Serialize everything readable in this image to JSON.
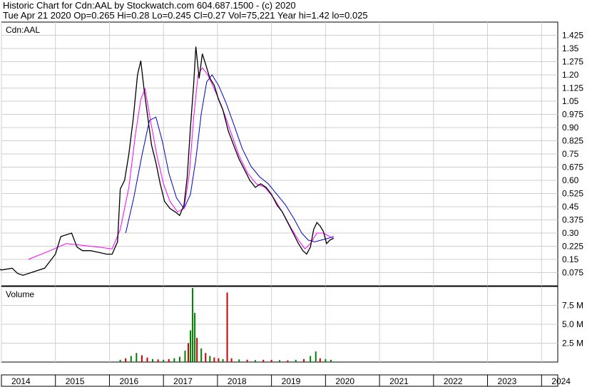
{
  "header": {
    "title": "Historic Chart for Cdn:AAL by Stockwatch.com 604.687.1500 - (c) 2020",
    "quote_line": "Tue Apr 21 2020  Op=0.265  Hi=0.28  Lo=0.245  Cl=0.27  Vol=75,221  Year hi=1.42  lo=0.025"
  },
  "chart_data": [
    {
      "type": "line",
      "title": "Cdn:AAL",
      "ylabel": "",
      "xlabel": "",
      "ylim": [
        0,
        1.5
      ],
      "y_ticks": [
        0.075,
        0.15,
        0.225,
        0.3,
        0.375,
        0.45,
        0.525,
        0.6,
        0.675,
        0.75,
        0.825,
        0.9,
        0.975,
        1.05,
        1.125,
        1.2,
        1.275,
        1.35,
        1.425
      ],
      "y_tick_labels": [
        "0.075",
        "0.15",
        "0.225",
        "0.30",
        "0.375",
        "0.45",
        "0.525",
        "0.60",
        "0.675",
        "0.75",
        "0.825",
        "0.90",
        "0.975",
        "1.05",
        "1.125",
        "1.20",
        "1.275",
        "1.35",
        "1.425"
      ],
      "x_labels": [
        "2014",
        "2015",
        "2016",
        "2017",
        "2018",
        "2019",
        "2020",
        "2021",
        "2022",
        "2023",
        "2024"
      ],
      "xlim": [
        2014.0,
        2024.3
      ],
      "grid": true,
      "colors": {
        "price": "#000000",
        "ma_short": "#ff00ff",
        "ma_long": "#0000cc",
        "up": "#008000",
        "down": "#cc0000"
      },
      "price_points": [
        [
          2013.85,
          0.11
        ],
        [
          2014.0,
          0.09
        ],
        [
          2014.2,
          0.1
        ],
        [
          2014.3,
          0.07
        ],
        [
          2014.4,
          0.06
        ],
        [
          2014.6,
          0.08
        ],
        [
          2014.8,
          0.1
        ],
        [
          2015.0,
          0.18
        ],
        [
          2015.1,
          0.28
        ],
        [
          2015.3,
          0.3
        ],
        [
          2015.4,
          0.22
        ],
        [
          2015.5,
          0.2
        ],
        [
          2015.65,
          0.2
        ],
        [
          2015.8,
          0.19
        ],
        [
          2015.95,
          0.18
        ],
        [
          2016.05,
          0.18
        ],
        [
          2016.15,
          0.25
        ],
        [
          2016.2,
          0.55
        ],
        [
          2016.28,
          0.6
        ],
        [
          2016.36,
          0.75
        ],
        [
          2016.44,
          0.95
        ],
        [
          2016.52,
          1.2
        ],
        [
          2016.58,
          1.28
        ],
        [
          2016.64,
          1.12
        ],
        [
          2016.7,
          0.98
        ],
        [
          2016.78,
          0.8
        ],
        [
          2016.86,
          0.7
        ],
        [
          2016.94,
          0.58
        ],
        [
          2017.02,
          0.48
        ],
        [
          2017.12,
          0.44
        ],
        [
          2017.22,
          0.42
        ],
        [
          2017.3,
          0.4
        ],
        [
          2017.38,
          0.46
        ],
        [
          2017.44,
          0.62
        ],
        [
          2017.5,
          0.9
        ],
        [
          2017.56,
          1.15
        ],
        [
          2017.6,
          1.36
        ],
        [
          2017.66,
          1.18
        ],
        [
          2017.72,
          1.32
        ],
        [
          2017.78,
          1.26
        ],
        [
          2017.86,
          1.18
        ],
        [
          2017.94,
          1.14
        ],
        [
          2018.02,
          1.06
        ],
        [
          2018.1,
          1.0
        ],
        [
          2018.2,
          0.88
        ],
        [
          2018.3,
          0.8
        ],
        [
          2018.4,
          0.72
        ],
        [
          2018.5,
          0.66
        ],
        [
          2018.6,
          0.6
        ],
        [
          2018.7,
          0.56
        ],
        [
          2018.8,
          0.58
        ],
        [
          2018.9,
          0.56
        ],
        [
          2019.0,
          0.52
        ],
        [
          2019.1,
          0.46
        ],
        [
          2019.2,
          0.42
        ],
        [
          2019.3,
          0.36
        ],
        [
          2019.4,
          0.3
        ],
        [
          2019.5,
          0.24
        ],
        [
          2019.58,
          0.2
        ],
        [
          2019.65,
          0.18
        ],
        [
          2019.72,
          0.22
        ],
        [
          2019.78,
          0.32
        ],
        [
          2019.84,
          0.36
        ],
        [
          2019.9,
          0.34
        ],
        [
          2019.96,
          0.31
        ],
        [
          2020.02,
          0.24
        ],
        [
          2020.08,
          0.26
        ],
        [
          2020.15,
          0.27
        ]
      ],
      "ma_short_points": [
        [
          2014.5,
          0.15
        ],
        [
          2014.9,
          0.2
        ],
        [
          2015.2,
          0.24
        ],
        [
          2015.5,
          0.23
        ],
        [
          2015.8,
          0.22
        ],
        [
          2016.05,
          0.21
        ],
        [
          2016.2,
          0.32
        ],
        [
          2016.36,
          0.56
        ],
        [
          2016.48,
          0.86
        ],
        [
          2016.58,
          1.06
        ],
        [
          2016.66,
          1.12
        ],
        [
          2016.76,
          0.94
        ],
        [
          2016.88,
          0.74
        ],
        [
          2017.0,
          0.58
        ],
        [
          2017.12,
          0.48
        ],
        [
          2017.26,
          0.42
        ],
        [
          2017.38,
          0.44
        ],
        [
          2017.48,
          0.64
        ],
        [
          2017.56,
          0.96
        ],
        [
          2017.64,
          1.2
        ],
        [
          2017.72,
          1.24
        ],
        [
          2017.82,
          1.2
        ],
        [
          2017.94,
          1.12
        ],
        [
          2018.08,
          1.02
        ],
        [
          2018.24,
          0.88
        ],
        [
          2018.4,
          0.74
        ],
        [
          2018.56,
          0.64
        ],
        [
          2018.72,
          0.58
        ],
        [
          2018.88,
          0.56
        ],
        [
          2019.04,
          0.5
        ],
        [
          2019.2,
          0.42
        ],
        [
          2019.36,
          0.33
        ],
        [
          2019.5,
          0.26
        ],
        [
          2019.62,
          0.21
        ],
        [
          2019.72,
          0.24
        ],
        [
          2019.84,
          0.3
        ],
        [
          2019.96,
          0.3
        ],
        [
          2020.08,
          0.28
        ],
        [
          2020.15,
          0.27
        ]
      ],
      "ma_long_points": [
        [
          2016.3,
          0.3
        ],
        [
          2016.45,
          0.5
        ],
        [
          2016.6,
          0.74
        ],
        [
          2016.74,
          0.94
        ],
        [
          2016.86,
          0.96
        ],
        [
          2016.98,
          0.82
        ],
        [
          2017.1,
          0.64
        ],
        [
          2017.24,
          0.5
        ],
        [
          2017.38,
          0.44
        ],
        [
          2017.5,
          0.52
        ],
        [
          2017.6,
          0.72
        ],
        [
          2017.7,
          0.98
        ],
        [
          2017.8,
          1.16
        ],
        [
          2017.9,
          1.2
        ],
        [
          2018.02,
          1.14
        ],
        [
          2018.16,
          1.04
        ],
        [
          2018.3,
          0.92
        ],
        [
          2018.46,
          0.78
        ],
        [
          2018.62,
          0.68
        ],
        [
          2018.78,
          0.62
        ],
        [
          2018.94,
          0.58
        ],
        [
          2019.1,
          0.52
        ],
        [
          2019.26,
          0.46
        ],
        [
          2019.42,
          0.38
        ],
        [
          2019.56,
          0.3
        ],
        [
          2019.68,
          0.26
        ],
        [
          2019.8,
          0.25
        ],
        [
          2019.92,
          0.26
        ],
        [
          2020.05,
          0.27
        ],
        [
          2020.15,
          0.28
        ]
      ]
    },
    {
      "type": "bar",
      "title": "Volume",
      "ylim": [
        0,
        10000000
      ],
      "y_ticks": [
        2500000,
        5000000,
        7500000
      ],
      "y_tick_labels": [
        "2.5 M",
        "5.0 M",
        "7.5 M"
      ],
      "grid": true,
      "volume_points": [
        [
          2016.2,
          300000,
          "up"
        ],
        [
          2016.3,
          500000,
          "down"
        ],
        [
          2016.4,
          800000,
          "up"
        ],
        [
          2016.5,
          1200000,
          "up"
        ],
        [
          2016.6,
          900000,
          "down"
        ],
        [
          2016.7,
          600000,
          "down"
        ],
        [
          2016.8,
          400000,
          "up"
        ],
        [
          2016.9,
          350000,
          "down"
        ],
        [
          2017.0,
          300000,
          "up"
        ],
        [
          2017.1,
          400000,
          "down"
        ],
        [
          2017.2,
          500000,
          "up"
        ],
        [
          2017.3,
          700000,
          "up"
        ],
        [
          2017.4,
          1500000,
          "up"
        ],
        [
          2017.46,
          2500000,
          "down"
        ],
        [
          2017.5,
          4200000,
          "up"
        ],
        [
          2017.54,
          9800000,
          "up"
        ],
        [
          2017.58,
          6500000,
          "up"
        ],
        [
          2017.62,
          3200000,
          "down"
        ],
        [
          2017.7,
          1800000,
          "up"
        ],
        [
          2017.78,
          1200000,
          "down"
        ],
        [
          2017.86,
          800000,
          "up"
        ],
        [
          2017.94,
          600000,
          "down"
        ],
        [
          2018.02,
          500000,
          "down"
        ],
        [
          2018.1,
          400000,
          "up"
        ],
        [
          2018.18,
          9200000,
          "down"
        ],
        [
          2018.26,
          500000,
          "down"
        ],
        [
          2018.4,
          350000,
          "up"
        ],
        [
          2018.55,
          300000,
          "down"
        ],
        [
          2018.7,
          250000,
          "up"
        ],
        [
          2018.85,
          300000,
          "down"
        ],
        [
          2019.0,
          280000,
          "down"
        ],
        [
          2019.15,
          250000,
          "up"
        ],
        [
          2019.3,
          220000,
          "down"
        ],
        [
          2019.45,
          300000,
          "up"
        ],
        [
          2019.6,
          400000,
          "down"
        ],
        [
          2019.72,
          800000,
          "up"
        ],
        [
          2019.82,
          1400000,
          "up"
        ],
        [
          2019.9,
          500000,
          "down"
        ],
        [
          2020.0,
          400000,
          "up"
        ],
        [
          2020.1,
          300000,
          "up"
        ]
      ]
    }
  ]
}
